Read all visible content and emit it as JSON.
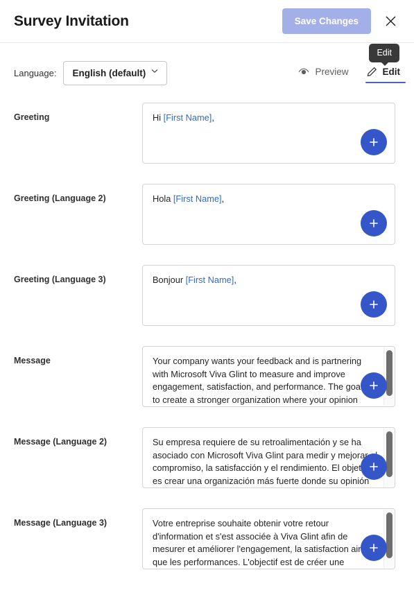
{
  "header": {
    "title": "Survey Invitation",
    "save_label": "Save Changes",
    "close_icon": "close-icon"
  },
  "toolbar": {
    "language_label": "Language:",
    "language_value": "English (default)",
    "chevron": "⌄",
    "preview_label": "Preview",
    "edit_label": "Edit",
    "tooltip": "Edit"
  },
  "fields": [
    {
      "label": "Greeting",
      "prefix": "Hi ",
      "placeholder_token": "[First Name]",
      "suffix": ",",
      "scrollable": false
    },
    {
      "label": "Greeting (Language 2)",
      "prefix": "Hola ",
      "placeholder_token": "[First Name]",
      "suffix": ",",
      "scrollable": false
    },
    {
      "label": "Greeting (Language 3)",
      "prefix": "Bonjour ",
      "placeholder_token": "[First Name]",
      "suffix": ",",
      "scrollable": false
    },
    {
      "label": "Message",
      "text": "Your company wants your feedback and is partnering with Microsoft Viva Glint to measure and improve engagement, satisfaction, and performance. The goal is to create a stronger organization where your opinion matters.",
      "scrollable": true
    },
    {
      "label": "Message (Language 2)",
      "text": "Su empresa requiere de su retroalimentación y se ha asociado con Microsoft Viva Glint para medir y mejorar el compromiso, la satisfacción y el rendimiento. El objetivo es crear una organización más fuerte donde su opinión sea importante.",
      "scrollable": true
    },
    {
      "label": "Message (Language 3)",
      "text": "Votre entreprise souhaite obtenir votre retour d'information et s'est associée à Viva Glint afin de mesurer et améliorer l'engagement, la satisfaction ainsi que les performances. L'objectif est de créer une organisation plus forte où l'opinion de chacun est prise en compte.",
      "scrollable": true
    }
  ],
  "add_button_label": "+",
  "colors": {
    "accent": "#3556c8",
    "tab_underline": "#4c60c4",
    "save_button": "#a3b0e8",
    "placeholder_text": "#2b6cd4",
    "tooltip_bg": "#393939"
  }
}
